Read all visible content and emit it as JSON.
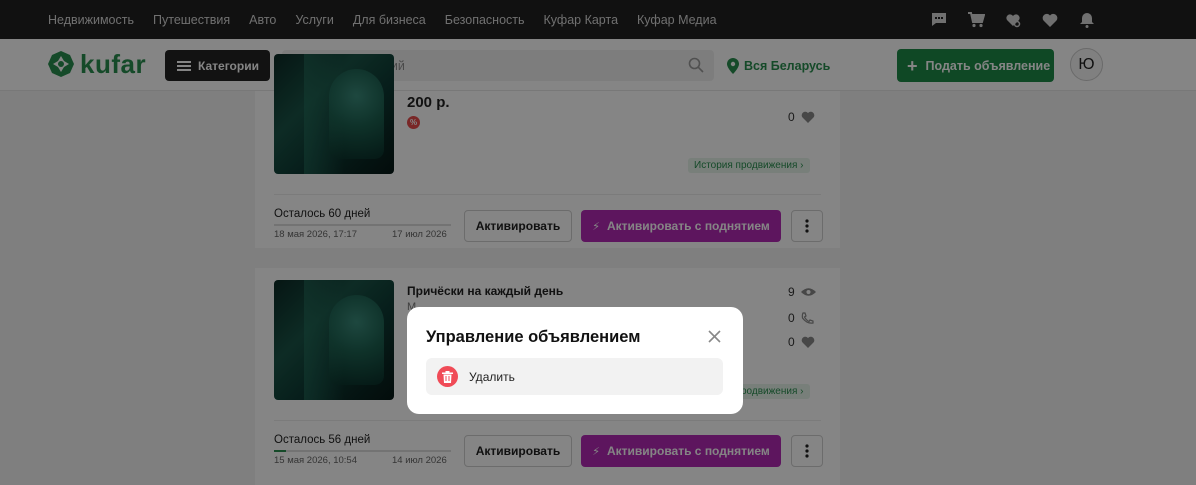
{
  "topnav": {
    "links": [
      "Недвижимость",
      "Путешествия",
      "Авто",
      "Услуги",
      "Для бизнеса",
      "Безопасность",
      "Куфар Карта",
      "Куфар Медиа"
    ],
    "icons": [
      "chat-icon",
      "cart-icon",
      "saved-search-icon",
      "heart-icon",
      "bell-icon"
    ]
  },
  "header": {
    "logo_text": "kufar",
    "categories_label": "Категории",
    "search_placeholder": "Поиск объявлений",
    "region_label": "Вся Беларусь",
    "post_ad_label": "Подать объявление",
    "avatar_initial": "Ю"
  },
  "listings": [
    {
      "price": "200 р.",
      "views": "0",
      "favorites": "0",
      "promo_history": "История продвижения",
      "remaining": "Осталось 60 дней",
      "date_from": "18 мая 2026, 17:17",
      "date_to": "17 июл 2026",
      "activate_label": "Активировать",
      "boost_label": "Активировать с поднятием"
    },
    {
      "title": "Причёски на каждый день",
      "subtitle": "М...",
      "views": "9",
      "calls": "0",
      "favorites": "0",
      "promo_history": "История продвижения",
      "remaining": "Осталось 56 дней",
      "date_from": "15 мая 2026, 10:54",
      "date_to": "14 июл 2026",
      "activate_label": "Активировать",
      "boost_label": "Активировать с поднятием"
    }
  ],
  "modal": {
    "title": "Управление объявлением",
    "items": [
      {
        "label": "Удалить",
        "icon": "trash-icon"
      }
    ]
  },
  "colors": {
    "brand_green": "#2a8f4f",
    "boost_purple": "#b22ab5",
    "delete_red": "#f04b57"
  }
}
